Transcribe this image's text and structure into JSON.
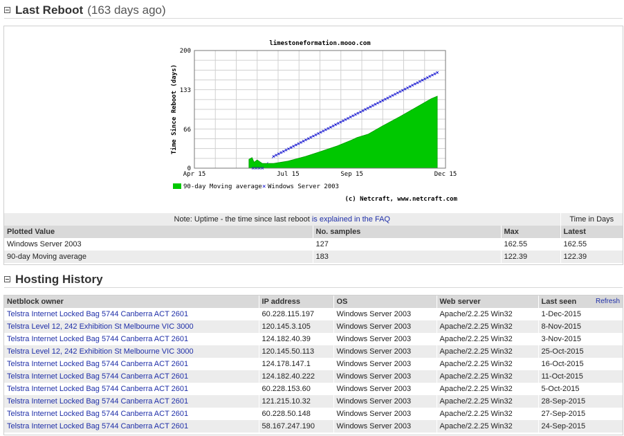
{
  "last_reboot": {
    "title": "Last Reboot",
    "subtitle": "(163 days ago)"
  },
  "chart_data": {
    "type": "area",
    "title": "limestoneformation.mooo.com",
    "ylabel": "Time Since Reboot (days)",
    "xlabel": "",
    "ylim": [
      0,
      200
    ],
    "yticks": [
      "0",
      "66",
      "133",
      "200"
    ],
    "xticks": [
      "Apr 15",
      "Jul 15",
      "Sep 15",
      "Dec 15"
    ],
    "grid": true,
    "legend_placement": "bottom",
    "copyright": "(c) Netcraft, www.netcraft.com",
    "series": [
      {
        "name": "90-day Moving average",
        "style": "area",
        "color": "#00c800",
        "x": [
          "2015-06-07",
          "2015-06-10",
          "2015-06-12",
          "2015-06-15",
          "2015-06-20",
          "2015-07-01",
          "2015-07-15",
          "2015-08-01",
          "2015-08-15",
          "2015-09-01",
          "2015-09-15",
          "2015-09-20",
          "2015-10-01",
          "2015-10-15",
          "2015-11-01",
          "2015-11-15",
          "2015-12-01",
          "2015-12-07"
        ],
        "values": [
          15,
          18,
          10,
          14,
          8,
          8,
          12,
          20,
          28,
          38,
          48,
          52,
          58,
          72,
          88,
          102,
          118,
          122.39
        ]
      },
      {
        "name": "Windows Server 2003",
        "style": "markers",
        "color": "#0000cc",
        "x": [
          "2015-06-11",
          "2015-06-20",
          "2015-07-01",
          "2015-12-07"
        ],
        "values": [
          0,
          0,
          20,
          162.55
        ]
      }
    ]
  },
  "stats": {
    "note_prefix": "Note: Uptime - the time since last reboot",
    "note_link": "is explained in the FAQ",
    "time_header": "Time in Days",
    "columns": [
      "Plotted Value",
      "No. samples",
      "Max",
      "Latest"
    ],
    "rows": [
      [
        "Windows Server 2003",
        "127",
        "162.55",
        "162.55"
      ],
      [
        "90-day Moving average",
        "183",
        "122.39",
        "122.39"
      ]
    ]
  },
  "hosting_history": {
    "title": "Hosting History",
    "refresh_label": "Refresh",
    "columns": [
      "Netblock owner",
      "IP address",
      "OS",
      "Web server",
      "Last seen"
    ],
    "rows": [
      [
        "Telstra Internet Locked Bag 5744 Canberra ACT 2601",
        "60.228.115.197",
        "Windows Server 2003",
        "Apache/2.2.25 Win32",
        "1-Dec-2015"
      ],
      [
        "Telstra Level 12, 242 Exhibition St Melbourne VIC 3000",
        "120.145.3.105",
        "Windows Server 2003",
        "Apache/2.2.25 Win32",
        "8-Nov-2015"
      ],
      [
        "Telstra Internet Locked Bag 5744 Canberra ACT 2601",
        "124.182.40.39",
        "Windows Server 2003",
        "Apache/2.2.25 Win32",
        "3-Nov-2015"
      ],
      [
        "Telstra Level 12, 242 Exhibition St Melbourne VIC 3000",
        "120.145.50.113",
        "Windows Server 2003",
        "Apache/2.2.25 Win32",
        "25-Oct-2015"
      ],
      [
        "Telstra Internet Locked Bag 5744 Canberra ACT 2601",
        "124.178.147.1",
        "Windows Server 2003",
        "Apache/2.2.25 Win32",
        "16-Oct-2015"
      ],
      [
        "Telstra Internet Locked Bag 5744 Canberra ACT 2601",
        "124.182.40.222",
        "Windows Server 2003",
        "Apache/2.2.25 Win32",
        "11-Oct-2015"
      ],
      [
        "Telstra Internet Locked Bag 5744 Canberra ACT 2601",
        "60.228.153.60",
        "Windows Server 2003",
        "Apache/2.2.25 Win32",
        "5-Oct-2015"
      ],
      [
        "Telstra Internet Locked Bag 5744 Canberra ACT 2601",
        "121.215.10.32",
        "Windows Server 2003",
        "Apache/2.2.25 Win32",
        "28-Sep-2015"
      ],
      [
        "Telstra Internet Locked Bag 5744 Canberra ACT 2601",
        "60.228.50.148",
        "Windows Server 2003",
        "Apache/2.2.25 Win32",
        "27-Sep-2015"
      ],
      [
        "Telstra Internet Locked Bag 5744 Canberra ACT 2601",
        "58.167.247.190",
        "Windows Server 2003",
        "Apache/2.2.25 Win32",
        "24-Sep-2015"
      ]
    ]
  }
}
